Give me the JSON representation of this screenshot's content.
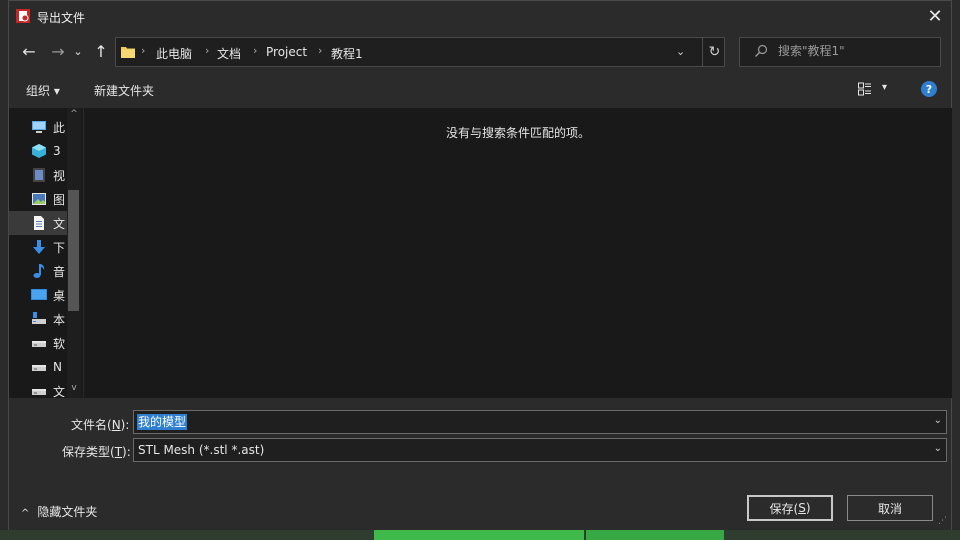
{
  "window": {
    "title": "导出文件",
    "close_glyph": "✕"
  },
  "nav": {
    "back_glyph": "←",
    "forward_glyph": "→",
    "history_glyph": "⌄",
    "up_glyph": "↑",
    "breadcrumb": [
      "此电脑",
      "文档",
      "Project",
      "教程1"
    ],
    "separator_glyph": "›",
    "address_dropdown_glyph": "⌄",
    "refresh_glyph": "↻"
  },
  "search": {
    "placeholder": "搜索\"教程1\"",
    "icon": "search-icon"
  },
  "toolbar": {
    "organize_label": "组织 ▾",
    "new_folder_label": "新建文件夹",
    "help_glyph": "?",
    "view_dropdown_glyph": "▾"
  },
  "sidebar": {
    "items": [
      {
        "label": "此",
        "icon": "computer-icon",
        "selected": false
      },
      {
        "label": "3",
        "icon": "3d-objects-icon",
        "selected": false
      },
      {
        "label": "视",
        "icon": "videos-icon",
        "selected": false
      },
      {
        "label": "图",
        "icon": "pictures-icon",
        "selected": false
      },
      {
        "label": "文",
        "icon": "documents-icon",
        "selected": true
      },
      {
        "label": "下",
        "icon": "downloads-icon",
        "selected": false
      },
      {
        "label": "音",
        "icon": "music-icon",
        "selected": false
      },
      {
        "label": "桌",
        "icon": "desktop-icon",
        "selected": false
      },
      {
        "label": "本",
        "icon": "local-disk-icon",
        "selected": false
      },
      {
        "label": "软",
        "icon": "drive-icon",
        "selected": false
      },
      {
        "label": "N",
        "icon": "drive-icon",
        "selected": false
      },
      {
        "label": "文",
        "icon": "drive-icon",
        "selected": false
      }
    ],
    "scroll_up_glyph": "^",
    "scroll_down_glyph": "v"
  },
  "content": {
    "empty_message": "没有与搜索条件匹配的项。"
  },
  "filename": {
    "label_prefix": "文件名(",
    "accel": "N",
    "label_suffix": "):",
    "value": "我的模型"
  },
  "filetype": {
    "label_prefix": "保存类型(",
    "accel": "T",
    "label_suffix": "):",
    "value": "STL Mesh (*.stl *.ast)"
  },
  "combo_arrow_glyph": "⌄",
  "footer": {
    "hide_folders_label": "隐藏文件夹",
    "hide_folders_glyph": "^",
    "save_prefix": "保存(",
    "save_accel": "S",
    "save_suffix": ")",
    "cancel_label": "取消",
    "grip_glyph": "⋰"
  },
  "colors": {
    "accent": "#2f7fd0",
    "window_bg": "#2b2b2b",
    "pane_bg": "#191919",
    "taskbar_green": "#3fb949"
  }
}
